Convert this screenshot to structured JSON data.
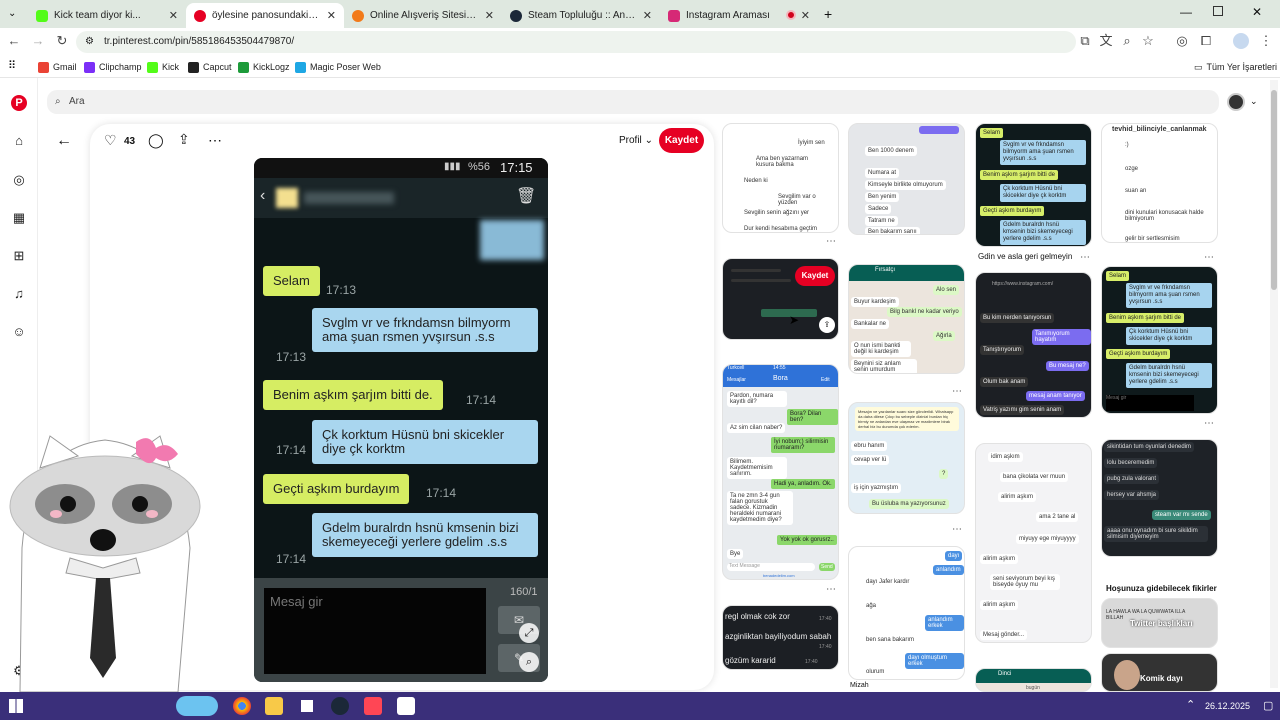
{
  "tabs": [
    {
      "title": "Kick team diyor ki...",
      "fav_color": "#53fc18",
      "active": false
    },
    {
      "title": "öylesine panosundaki Pin",
      "fav_color": "#e60023",
      "active": true
    },
    {
      "title": "Online Alışveriş Sitesi, Türkiye'n",
      "fav_color": "#f27a1a",
      "active": false
    },
    {
      "title": "Steam Topluluğu :: Anı 48 yea",
      "fav_color": "#1b2838",
      "active": false
    },
    {
      "title": "Instagram Araması",
      "fav_color": "#d62976",
      "active": false
    }
  ],
  "url": "tr.pinterest.com/pin/585186453504479870/",
  "bookmarks": [
    {
      "label": "Gmail",
      "color": "#ea4335"
    },
    {
      "label": "Clipchamp",
      "color": "#7b2ff7"
    },
    {
      "label": "Kick",
      "color": "#53fc18"
    },
    {
      "label": "Capcut",
      "color": "#222222"
    },
    {
      "label": "KickLogz",
      "color": "#1d9b3a"
    },
    {
      "label": "Magic Poser Web",
      "color": "#1ea7e4"
    }
  ],
  "bookmarks_all": "Tüm Yer İşaretleri",
  "search_placeholder": "Ara",
  "pin": {
    "likes": "43",
    "profile_label": "Profil",
    "save_label": "Kaydet"
  },
  "phone": {
    "battery": "%56",
    "time": "17:15",
    "messages": [
      {
        "type": "green",
        "text": "Selam",
        "time": "17:13"
      },
      {
        "type": "blue",
        "text": "Svglm vr ve frkndamsn bilmyorm ama şuan rsmen yvşırsun .s.s",
        "time": "17:13"
      },
      {
        "type": "green",
        "text": "Benim aşkım şarjım bitti de.",
        "time": "17:14"
      },
      {
        "type": "blue",
        "text": "Çk korktum Hüsnü bni skicekler diye çk korktm",
        "time": "17:14"
      },
      {
        "type": "green",
        "text": "Geçti aşkım burdayım",
        "time": "17:14"
      },
      {
        "type": "blue",
        "text": "Gdelm buralrdn hsnü kmsenin bizi skemeyeceği yerlere gdelim .s.s",
        "time": "17:14"
      }
    ],
    "input_placeholder": "Mesaj gir",
    "counter": "160/1"
  },
  "tiles": {
    "t1_lines": [
      "İyiyim sen",
      "Ama ben yazarnam kusura bakma",
      "Neden ki",
      "Sevgilim var o yüzden",
      "Sevgilin senin ağzını yer",
      "Dur kendi hesabıma geçtim"
    ],
    "t2_lines": [
      "Ben 1000 denem",
      "Numara at",
      "Kimseyle birlikte olmuyorum",
      "Ben yenim",
      "Sadece",
      "Tatram ne",
      "Ben bakarım sanıı"
    ],
    "t3_msgs": [
      "Selam",
      "Svglm vr ve frkndamsn bilmyorm ama şuan rsmen yvşırsun .s.s",
      "Benim aşkım şarjım bitti de",
      "Çk korktum Hüsnü bni skicekler diye çk korktm",
      "Geçti aşkım burdayım",
      "Gdelm buralrdn hsnü kmsenin bizi skemeyecegi yerlere gdelim .s.s"
    ],
    "t4_header": "tevhid_bilinciyle_canlanmak",
    "t4_lines": [
      ":)",
      "ozge",
      "suan an",
      "dini kunulari konusacak halde bilmiyorum",
      "gelir bir sertlesmisim"
    ],
    "t4_caption": "Gdin ve asla geri gelmeyin",
    "t5_save": "Kaydet",
    "t6_name": "Fırsatçı",
    "t6_lines": [
      "Alo sen",
      "Buyur kardeşim",
      "Bilg bankl ne kadar veriyo",
      "Bankalar ne",
      "Ağırla",
      "O nun ismi bankti değil ki kardeşim",
      "Beynini siz anlam senin umurdum"
    ],
    "t7_url": "https://www.instagram.com/",
    "t7_lines": [
      "Bu kim nerden tanıyorsun",
      "Tanımıyorum hayatım",
      "Tanıştırıyorum",
      "Bu mesaj ne?",
      "Olum bak anam",
      "mesaj anam tanıyor",
      "Vatriş yazımı gim senin anam"
    ],
    "t8_msgs": [
      "Selam",
      "Svglm vr ve frkndamsn bilmyorm ama şuan rsmen yvşırsun .s.s",
      "Benim aşkım şarjım bitti de",
      "Çk korktum Hüsnü bni skicekler diye çk korktm",
      "Geçti aşkım burdayım",
      "Gdelm buralrdn hsnü kmsenin bizi skemeyecegi yerlere gdelim .s.s",
      "Mesaj gir"
    ],
    "t9_header": [
      "Turkcell",
      "14:55"
    ],
    "t9_title": "Bora",
    "t9_nav": [
      "Mesajlar",
      "Edit"
    ],
    "t9_msgs": [
      "Pardon, numara kayıtlı dil?",
      "Bora? Dilan ben?",
      "Az sim cilan naber?",
      "İyi nobum;) silirmisin numaramı?",
      "Bilimem. Kaydetmemisim sanırım.",
      "Hadi ya, anladım. Ok.",
      "Ta ne zmn 3-4 gun falan gorustuk sadece. Kizmadin heraldeki numarani kaydetmedim diye?",
      "Yok yok ok gorusrz..",
      "Bye"
    ],
    "t9_input": "Text Message",
    "t9_send": "Send",
    "t9_footer": "benadedelim.com",
    "t10_lines": [
      "Mesajın ve yazılanlar suanı size gönderildi. Whatsapp da daha dilese Çıkıp bu sebeple dizinizi burdan hiç birmiy ne anlardan eve ulaşmaz ve maxiimlere birak derhal biz bu durumda çok ederim.",
      "ebru hanım",
      "cevap ver lü",
      "?",
      "iş için yazmıştım",
      "Bu üsluba ma yazıyorsunuz"
    ],
    "t11_lines": [
      "idim aşkım",
      "bana çikolata ver muun",
      "alirim aşkım",
      "ama 2 tane al",
      "miyuyy ege miyuyyyy",
      "alirim aşkım",
      "seni seviyorum beyi kış biseyde oyuy mu",
      "alirim aşkım",
      "Mesaj gönder..."
    ],
    "t12_lines": [
      "sikintidan tum oyunlari denedim",
      "lolu beceremedim",
      "pubg zula valorant",
      "hersey var ahsmja",
      "steam var mı sende",
      "aaaa onu oynadım bi sure sikildim silmisim diyemeyim"
    ],
    "t12_caption": "Hoşunuza gidebilecek fikirler",
    "t13_lines": [
      "regl olmak cok zor",
      "azginliktan bayiliyodum sabah",
      "gözüm kararid"
    ],
    "t13_times": [
      "17:40",
      "17:40",
      "17:40"
    ],
    "t14_lines": [
      "dayı",
      "dayı Jafer kardır",
      "anlandım",
      "ağa",
      "anlandım erkek",
      "ben sana bakarım",
      "dayı olmuştum erkek",
      "olurum"
    ],
    "t15_header": "Dinci",
    "t15_sub": "bugün",
    "t16_title": "LA HAWLA WA LA QUWWATA ILLA BILLAH",
    "t16_sub": "Twitter başlıkları",
    "t17_label": "Komik dayı",
    "t17_caption": "Mizah"
  },
  "taskbar": {
    "time": "",
    "date": "26.12.2025"
  }
}
